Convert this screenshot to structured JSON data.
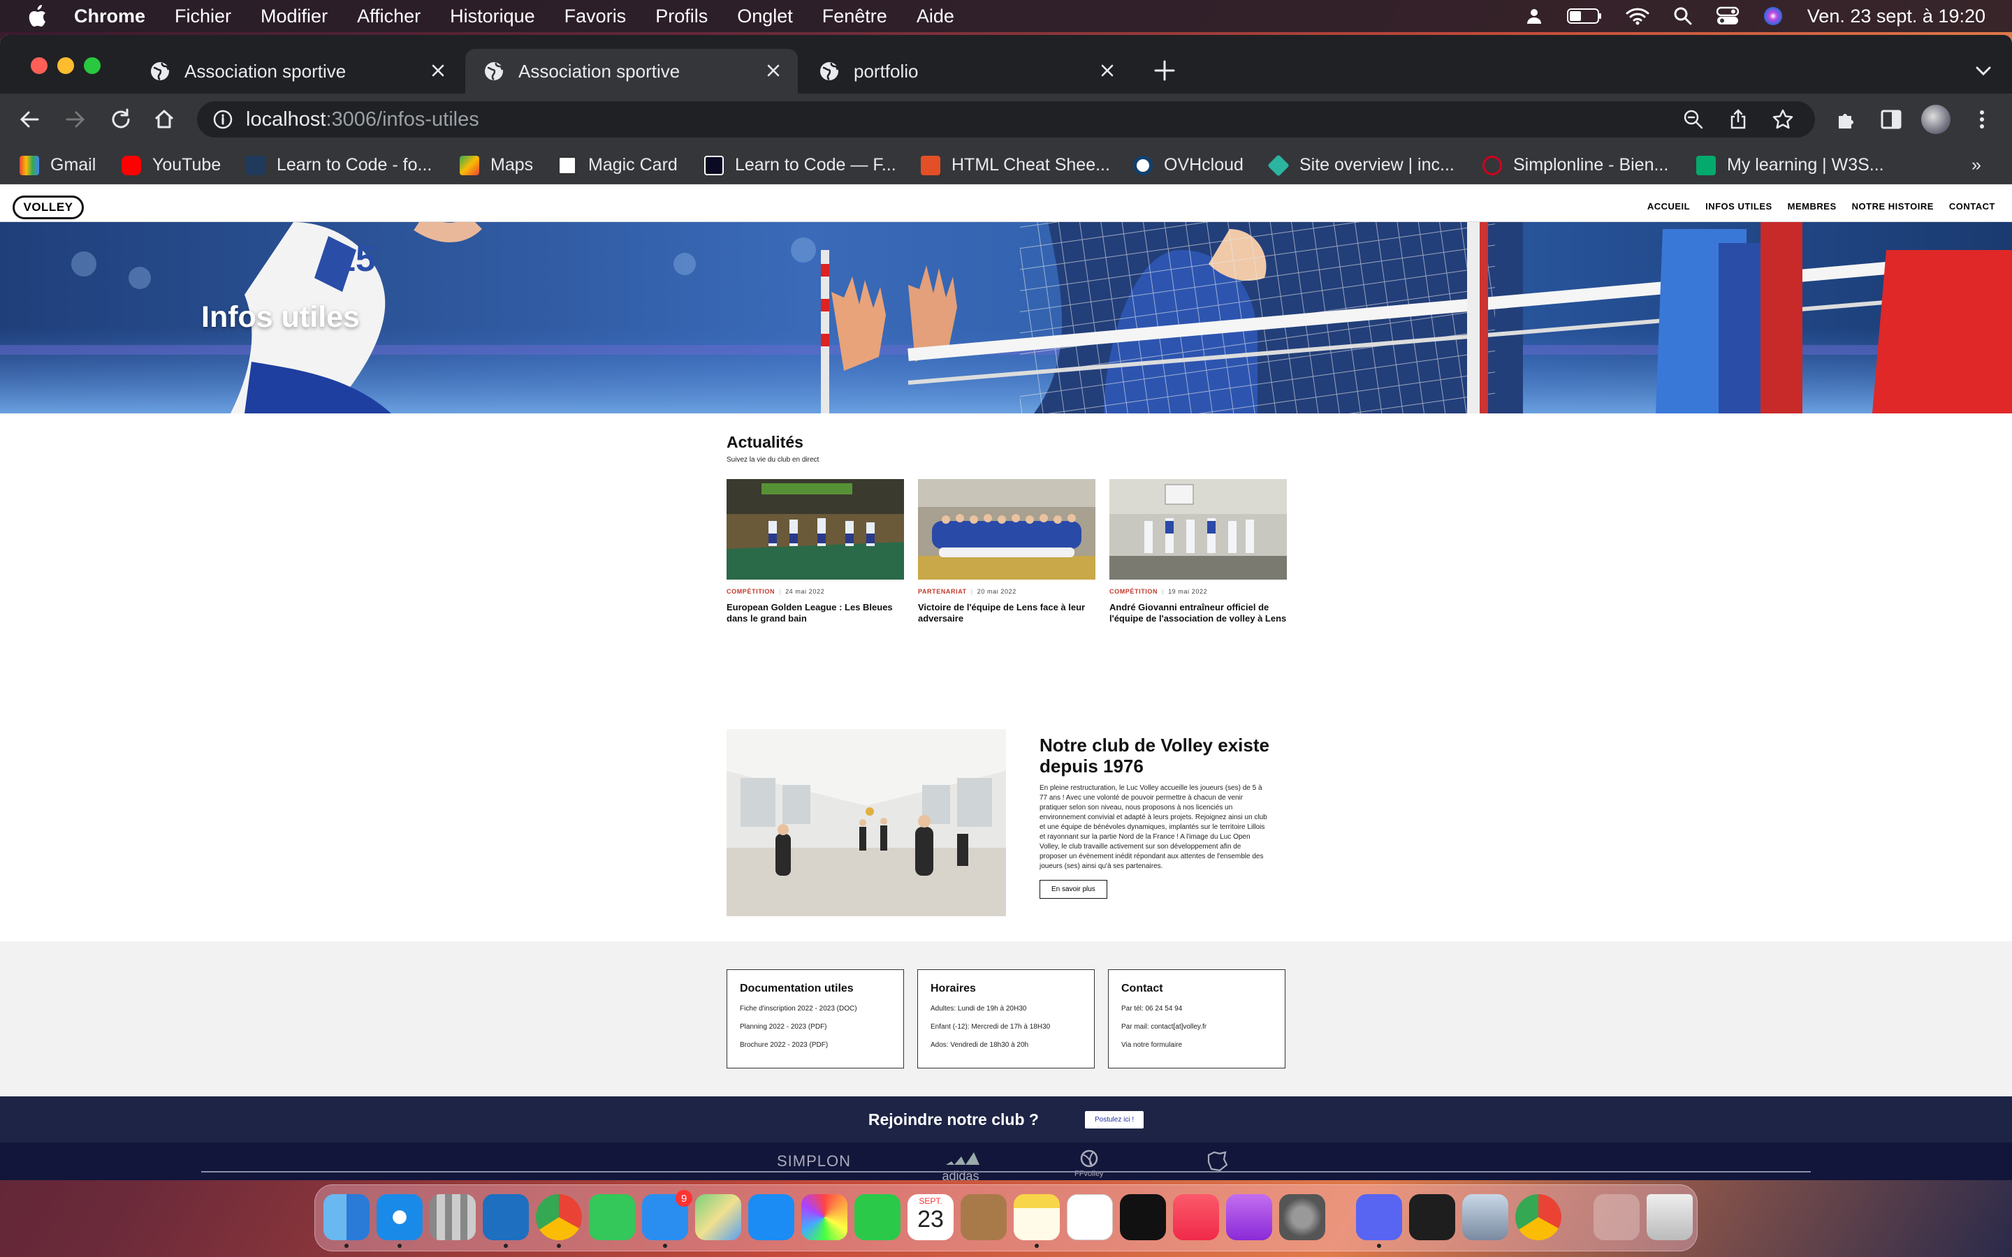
{
  "menubar": {
    "app": "Chrome",
    "items": [
      "Fichier",
      "Modifier",
      "Afficher",
      "Historique",
      "Favoris",
      "Profils",
      "Onglet",
      "Fenêtre",
      "Aide"
    ],
    "datetime": "Ven. 23 sept. à  19:20"
  },
  "tabs": [
    {
      "title": "Association sportive"
    },
    {
      "title": "Association sportive"
    },
    {
      "title": "portfolio"
    }
  ],
  "address": {
    "host": "localhost",
    "rest": ":3006/infos-utiles"
  },
  "bookmarks": [
    "Gmail",
    "YouTube",
    "Learn to Code - fo...",
    "Maps",
    "Magic Card",
    "Learn to Code — F...",
    "HTML Cheat Shee...",
    "OVHcloud",
    "Site overview | inc...",
    "Simplonline - Bien...",
    "My learning | W3S..."
  ],
  "bookmarks_more": "»",
  "site": {
    "logo": "VOLLEY",
    "nav": [
      "ACCUEIL",
      "INFOS UTILES",
      "MEMBRES",
      "NOTRE HISTOIRE",
      "CONTACT"
    ],
    "hero_title": "Infos utiles",
    "news": {
      "title": "Actualités",
      "subtitle": "Suivez la vie du club en direct",
      "cards": [
        {
          "category": "COMPÉTITION",
          "date": "24 mai 2022",
          "title": "European Golden League : Les Bleues dans le grand bain"
        },
        {
          "category": "PARTENARIAT",
          "date": "20 mai 2022",
          "title": "Victoire de l'équipe de Lens face à leur adversaire"
        },
        {
          "category": "COMPÉTITION",
          "date": "19 mai 2022",
          "title": "André Giovanni entraîneur officiel de l'équipe de l'association de volley à Lens"
        }
      ]
    },
    "about": {
      "title": "Notre club de Volley existe depuis 1976",
      "text": "En pleine restructuration, le Luc Volley accueille les joueurs (ses) de 5 à 77 ans ! Avec une volonté de pouvoir permettre à chacun de venir pratiquer selon son niveau, nous proposons à nos licenciés un environnement convivial et adapté à leurs projets. Rejoignez ainsi un club et une équipe de bénévoles dynamiques, implantés sur le territoire Lillois et rayonnant sur la partie Nord de la France ! A l'image du Luc Open Volley, le club travaille activement sur son développement afin de proposer un évènement inédit répondant aux attentes de l'ensemble des joueurs (ses) ainsi qu'à ses partenaires.",
      "button": "En savoir plus"
    },
    "infos": [
      {
        "title": "Documentation utiles",
        "lines": [
          "Fiche d'inscription 2022 - 2023 (DOC)",
          "Planning 2022 - 2023 (PDF)",
          "Brochure 2022 - 2023 (PDF)"
        ]
      },
      {
        "title": "Horaires",
        "lines": [
          "Adultes: Lundi de 19h à 20H30",
          "Enfant (-12): Mercredi de 17h à 18H30",
          "Ados: Vendredi de 18h30 à 20h"
        ]
      },
      {
        "title": "Contact",
        "lines": [
          "Par tél: 06 24 54 94",
          "Par mail: contact[at]volley.fr",
          "Via notre formulaire"
        ]
      }
    ],
    "join": {
      "text": "Rejoindre notre club ?",
      "button": "Postulez ici !"
    },
    "sponsors": [
      "SIMPLON",
      "adidas",
      "FFvolley"
    ]
  },
  "dock": {
    "calendar_month": "SEPT.",
    "calendar_day": "23",
    "mail_badge": "9"
  }
}
